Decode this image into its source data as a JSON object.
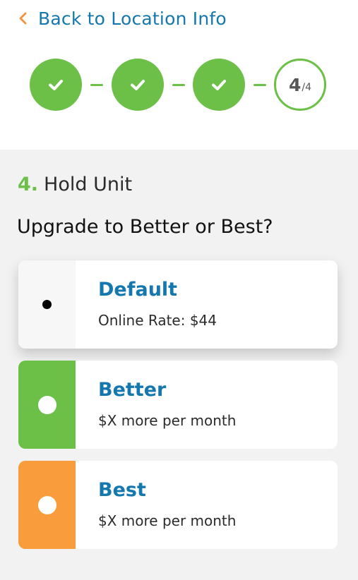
{
  "nav": {
    "back_label": "Back to Location Info",
    "back_icon": "chevron-left-icon",
    "accent_color": "#f5913a"
  },
  "stepper": {
    "completed_steps": 3,
    "current_step": "4",
    "total_steps": "/4",
    "done_icon": "check-icon",
    "color": "#6cbf47"
  },
  "section": {
    "number": "4.",
    "title": "Hold Unit",
    "question": "Upgrade to Better or Best?"
  },
  "options": [
    {
      "title": "Default",
      "subtitle": "Online Rate: $44",
      "selected": true,
      "color": "#f7f7f7"
    },
    {
      "title": "Better",
      "subtitle": "$X more per month",
      "selected": false,
      "color": "#6cbf47"
    },
    {
      "title": "Best",
      "subtitle": "$X more per month",
      "selected": false,
      "color": "#f99c3b"
    }
  ]
}
